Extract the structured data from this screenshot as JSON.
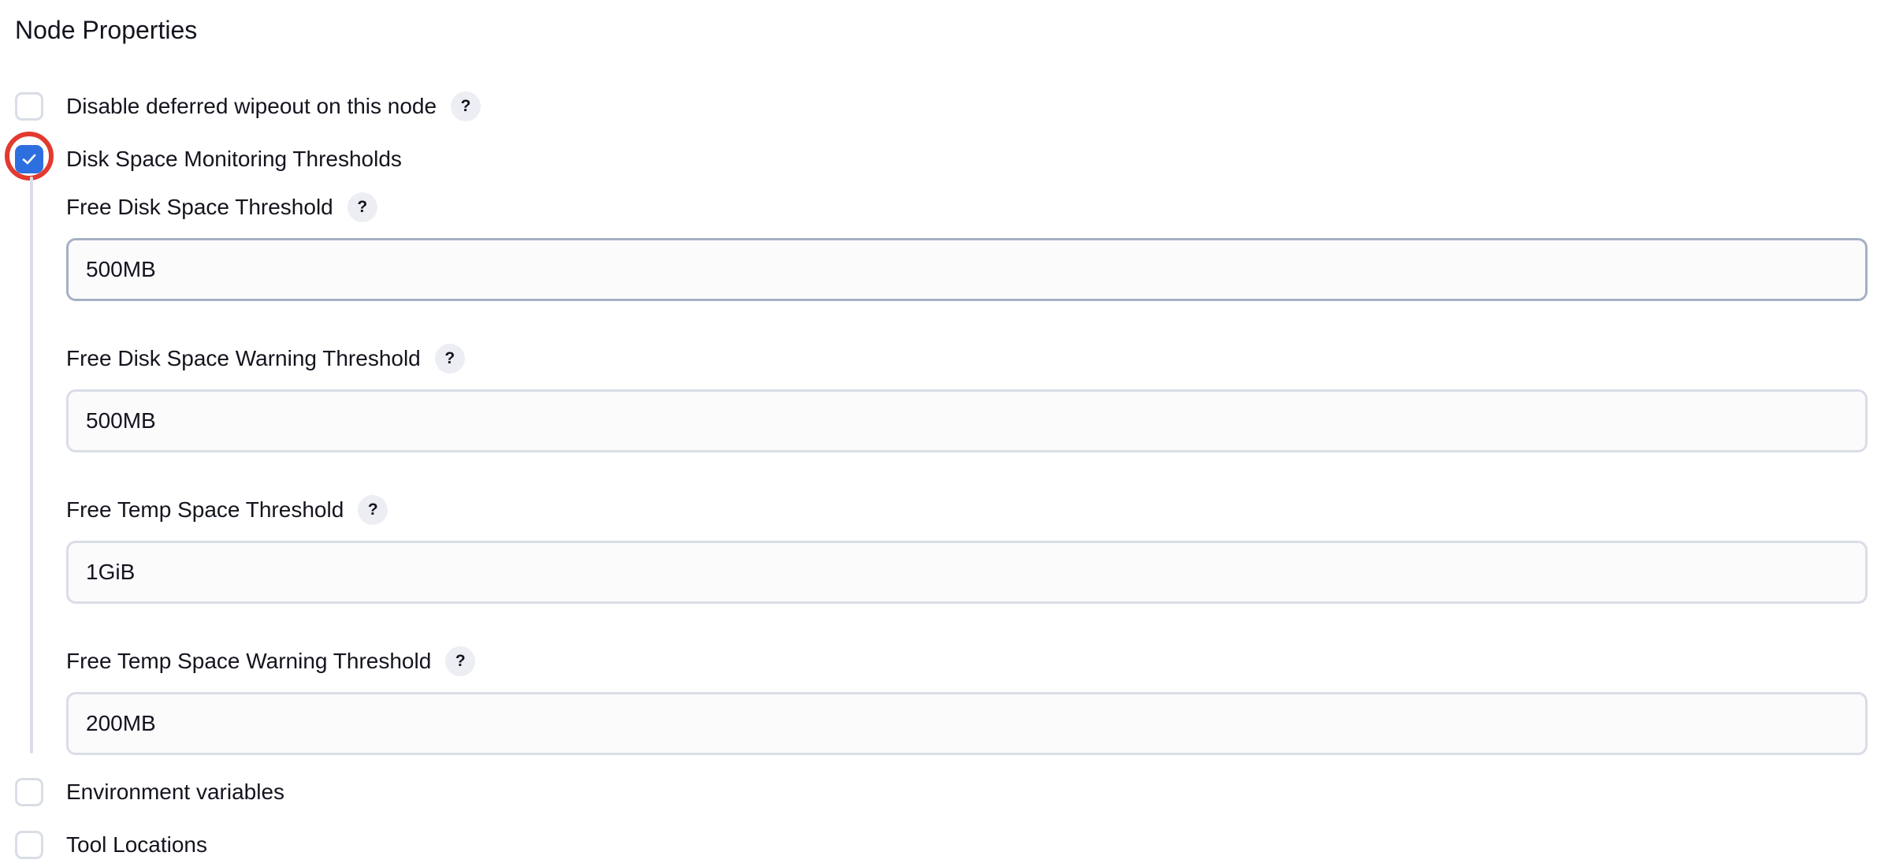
{
  "section": {
    "title": "Node Properties"
  },
  "options": [
    {
      "label": "Disable deferred wipeout on this node",
      "checked": false,
      "help": "?"
    },
    {
      "label": "Disk Space Monitoring Thresholds",
      "checked": true
    },
    {
      "label": "Environment variables",
      "checked": false
    },
    {
      "label": "Tool Locations",
      "checked": false
    }
  ],
  "disk_thresholds": {
    "fields": [
      {
        "label": "Free Disk Space Threshold",
        "value": "500MB",
        "help": "?"
      },
      {
        "label": "Free Disk Space Warning Threshold",
        "value": "500MB",
        "help": "?"
      },
      {
        "label": "Free Temp Space Threshold",
        "value": "1GiB",
        "help": "?"
      },
      {
        "label": "Free Temp Space Warning Threshold",
        "value": "200MB",
        "help": "?"
      }
    ]
  },
  "colors": {
    "accent": "#2e6fe0",
    "highlight_ring": "#e33a2f",
    "border": "#d9dde6",
    "help_bg": "#eceef3"
  },
  "icons": {
    "checkmark": "check-icon",
    "help": "question-mark-icon"
  }
}
